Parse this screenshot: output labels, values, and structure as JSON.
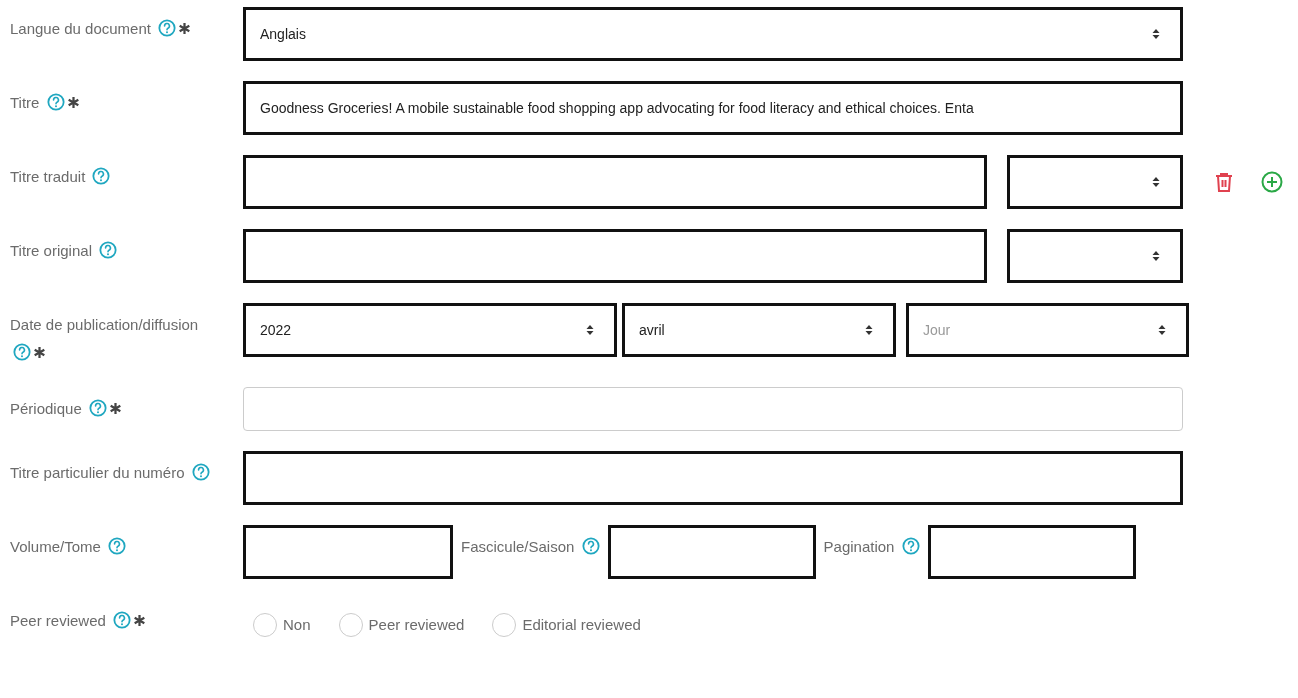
{
  "rows": [
    {
      "kind": "single",
      "label": "Langue du document",
      "help": true,
      "required": true,
      "controls": [
        {
          "kind": "select",
          "value": "Anglais",
          "highlighted": true
        }
      ]
    },
    {
      "kind": "single",
      "label": "Titre",
      "help": true,
      "required": true,
      "controls": [
        {
          "kind": "text",
          "value": "Goodness Groceries! A mobile sustainable food shopping app advocating for food literacy and ethical choices. Enta",
          "highlighted": true
        }
      ]
    },
    {
      "kind": "pair",
      "label": "Titre traduit",
      "help": true,
      "required": false,
      "controls": [
        {
          "kind": "text",
          "highlighted": true
        },
        {
          "kind": "select",
          "highlighted": true
        }
      ],
      "actions": [
        {
          "kind": "delete"
        },
        {
          "kind": "add"
        }
      ]
    },
    {
      "kind": "pair",
      "label": "Titre original",
      "help": true,
      "required": false,
      "controls": [
        {
          "kind": "text",
          "highlighted": true
        },
        {
          "kind": "select",
          "highlighted": true
        }
      ]
    },
    {
      "kind": "date",
      "label": "Date de publication/diffusion",
      "help": true,
      "required": true,
      "controls": [
        {
          "kind": "select",
          "value": "2022",
          "highlighted": true
        },
        {
          "kind": "select",
          "value": "avril",
          "highlighted": true
        },
        {
          "kind": "select",
          "placeholder": "Jour",
          "highlighted": true
        }
      ]
    },
    {
      "kind": "single",
      "label": "Périodique",
      "help": true,
      "required": true,
      "controls": [
        {
          "kind": "text",
          "highlighted": false
        }
      ]
    },
    {
      "kind": "single",
      "label": "Titre particulier du numéro",
      "help": true,
      "required": false,
      "controls": [
        {
          "kind": "text",
          "highlighted": true
        }
      ]
    },
    {
      "kind": "triple",
      "label": "Volume/Tome",
      "help": true,
      "required": false,
      "controls": [
        {
          "kind": "text",
          "highlighted": true
        },
        {
          "kind": "sublabel",
          "label": "Fascicule/Saison",
          "help": true
        },
        {
          "kind": "text",
          "highlighted": true
        },
        {
          "kind": "sublabel",
          "label": "Pagination",
          "help": true
        },
        {
          "kind": "text",
          "highlighted": true
        }
      ]
    },
    {
      "kind": "radio",
      "label": "Peer reviewed",
      "help": true,
      "required": true,
      "controls": [
        {
          "kind": "radio",
          "label": "Non",
          "selected": false
        },
        {
          "kind": "radio",
          "label": "Peer reviewed",
          "selected": false
        },
        {
          "kind": "radio",
          "label": "Editorial reviewed",
          "selected": false
        }
      ]
    }
  ]
}
